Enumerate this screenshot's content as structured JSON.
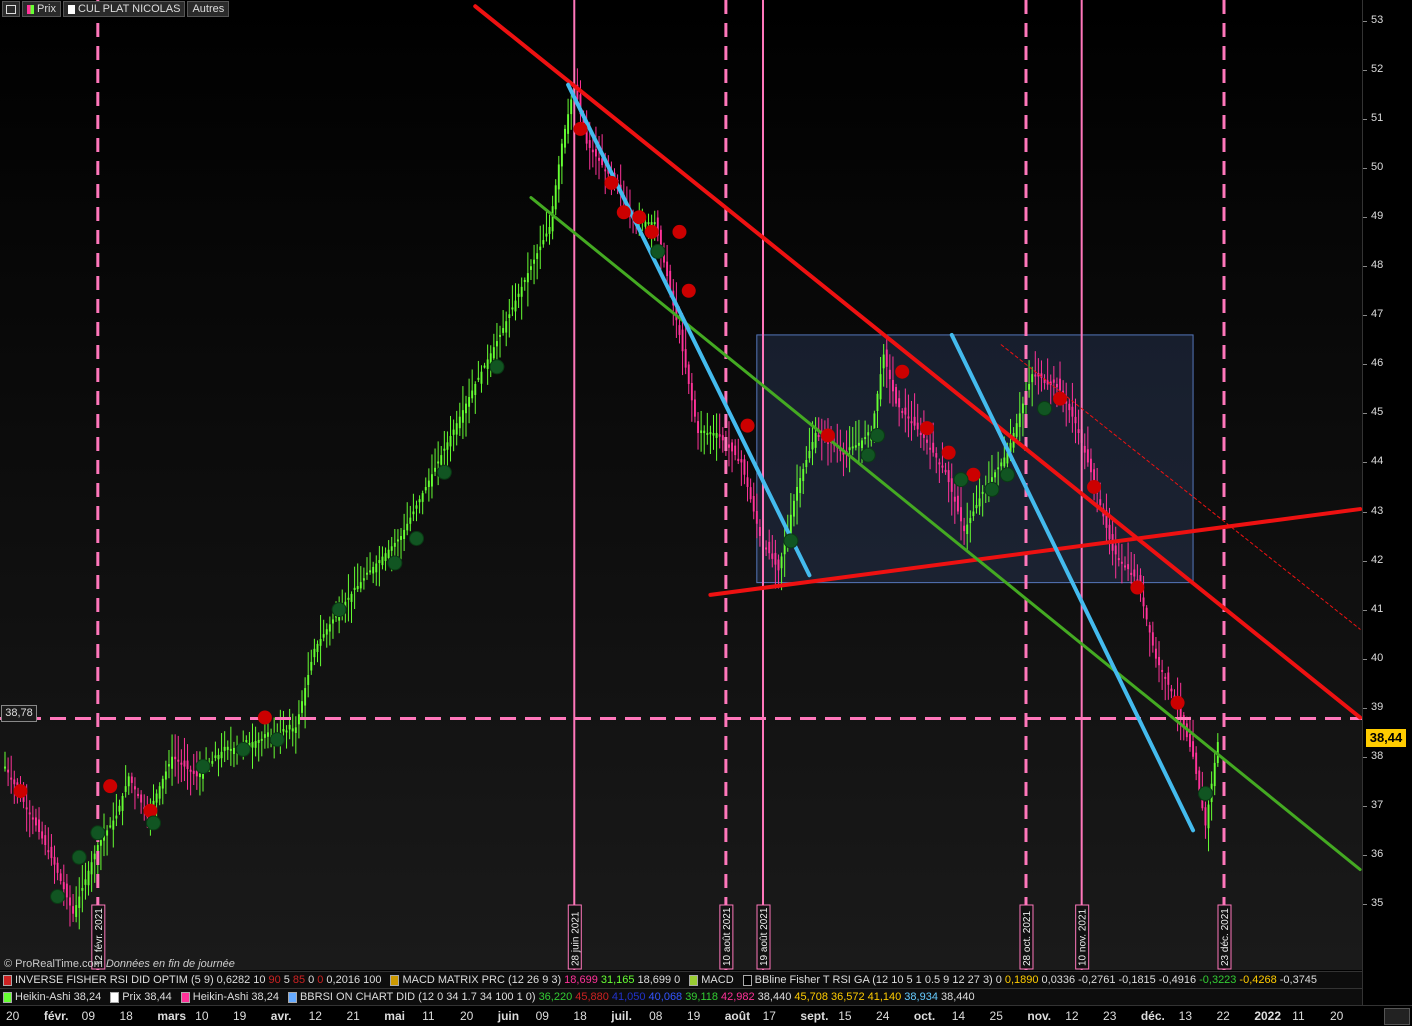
{
  "toolbar": {
    "prix_label": "Prix",
    "model_label": "CUL PLAT NICOLAS",
    "autres_label": "Autres"
  },
  "left_price_tag": "38,78",
  "current_price_tag": "38,44",
  "watermark": {
    "brand": "© ProRealTime.com",
    "note": "Données en fin de journée"
  },
  "legend_row1": [
    {
      "label": "INVERSE FISHER RSI DID OPTIM (5 9)",
      "color": "#cc2222",
      "values": [
        {
          "v": "0,6282",
          "c": "#ddd"
        },
        {
          "v": "10",
          "c": "#ddd"
        },
        {
          "v": "90",
          "c": "#cc2222"
        },
        {
          "v": "5",
          "c": "#ddd"
        },
        {
          "v": "85",
          "c": "#cc2222"
        },
        {
          "v": "0",
          "c": "#ddd"
        },
        {
          "v": "0",
          "c": "#cc2222"
        },
        {
          "v": "0,2016",
          "c": "#ddd"
        },
        {
          "v": "100",
          "c": "#ddd"
        }
      ]
    },
    {
      "label": "MACD MATRIX PRC (12 26 9 3)",
      "color": "#cc9900",
      "values": [
        {
          "v": "18,699",
          "c": "#ff3399"
        },
        {
          "v": "31,165",
          "c": "#66ff33"
        },
        {
          "v": "18,699",
          "c": "#ddd"
        },
        {
          "v": "0",
          "c": "#ddd"
        }
      ]
    },
    {
      "label": "MACD",
      "color": "#99cc33",
      "values": []
    },
    {
      "label": "BBline  Fisher T RSI  GA (12 10 5 1 0.5 9 12 27 3)",
      "color": "#000",
      "values": [
        {
          "v": "0",
          "c": "#ddd"
        },
        {
          "v": "0,1890",
          "c": "#ffcc00"
        },
        {
          "v": "0,0336",
          "c": "#ddd"
        },
        {
          "v": "-0,2761",
          "c": "#ddd"
        },
        {
          "v": "-0,1815",
          "c": "#ddd"
        },
        {
          "v": "-0,4916",
          "c": "#ddd"
        },
        {
          "v": "-0,3223",
          "c": "#33cc33"
        },
        {
          "v": "-0,4268",
          "c": "#ffcc00"
        },
        {
          "v": "-0,3745",
          "c": "#ddd"
        }
      ]
    }
  ],
  "legend_row2": [
    {
      "label": "Heikin-Ashi 38,24",
      "color": "#66ff33",
      "values": []
    },
    {
      "label": "Prix 38,44",
      "color": "#ffffff",
      "values": []
    },
    {
      "label": "Heikin-Ashi 38,24",
      "color": "#ff3399",
      "values": []
    },
    {
      "label": "BBRSI ON CHART DID (12 0 34 1.7 34 100 1 0)",
      "color": "#66aaff",
      "values": [
        {
          "v": "36,220",
          "c": "#33cc33"
        },
        {
          "v": "45,880",
          "c": "#cc2222"
        },
        {
          "v": "41,050",
          "c": "#2233cc"
        },
        {
          "v": "40,068",
          "c": "#3355ff"
        },
        {
          "v": "39,118",
          "c": "#33cc33"
        },
        {
          "v": "42,982",
          "c": "#ff3399"
        },
        {
          "v": "38,440",
          "c": "#ddd"
        },
        {
          "v": "45,708",
          "c": "#ffcc00"
        },
        {
          "v": "36,572",
          "c": "#ffcc00"
        },
        {
          "v": "41,140",
          "c": "#ffcc00"
        },
        {
          "v": "38,934",
          "c": "#66ccff"
        },
        {
          "v": "38,440",
          "c": "#ddd"
        }
      ]
    }
  ],
  "colors": {
    "bull": "#66ff33",
    "bear": "#ff3399",
    "trend_red": "#ee1111",
    "trend_blue": "#44bbee",
    "trend_green": "#44aa22",
    "dash_pink": "#ff77bb",
    "box_fill": "#2a3a5a",
    "box_stroke": "#5577bb",
    "dot_red": "#cc0000",
    "dot_green": "#115522"
  },
  "chart_data": {
    "type": "candlestick",
    "title": "",
    "y_ticks": [
      35,
      36,
      37,
      38,
      39,
      40,
      41,
      42,
      43,
      44,
      45,
      46,
      47,
      48,
      49,
      50,
      51,
      52,
      53
    ],
    "ylim": [
      34,
      53.3
    ],
    "x_ticks": [
      "20",
      "févr.",
      "09",
      "18",
      "mars",
      "10",
      "19",
      "avr.",
      "12",
      "21",
      "mai",
      "11",
      "20",
      "juin",
      "09",
      "18",
      "juil.",
      "08",
      "19",
      "août",
      "17",
      "sept.",
      "15",
      "24",
      "oct.",
      "14",
      "25",
      "nov.",
      "12",
      "23",
      "déc.",
      "13",
      "22",
      "2022",
      "11",
      "20"
    ],
    "x_tick_bold": [
      "févr.",
      "mars",
      "avr.",
      "mai",
      "juin",
      "juil.",
      "août",
      "sept.",
      "oct.",
      "nov.",
      "déc.",
      "2022"
    ],
    "n_bars": 260,
    "price_path": [
      [
        0,
        37.8
      ],
      [
        10,
        36.6
      ],
      [
        16,
        35.8
      ],
      [
        22,
        34.8
      ],
      [
        30,
        36.2
      ],
      [
        36,
        36.8
      ],
      [
        40,
        37.6
      ],
      [
        46,
        36.8
      ],
      [
        54,
        38.0
      ],
      [
        62,
        37.6
      ],
      [
        70,
        38.1
      ],
      [
        80,
        38.3
      ],
      [
        94,
        38.6
      ],
      [
        100,
        40.2
      ],
      [
        108,
        41.0
      ],
      [
        118,
        41.8
      ],
      [
        128,
        42.5
      ],
      [
        136,
        43.5
      ],
      [
        146,
        44.8
      ],
      [
        152,
        45.6
      ],
      [
        160,
        46.6
      ],
      [
        170,
        48.0
      ],
      [
        176,
        48.8
      ],
      [
        180,
        50.5
      ],
      [
        184,
        51.7
      ],
      [
        188,
        50.5
      ],
      [
        196,
        49.8
      ],
      [
        204,
        48.9
      ],
      [
        210,
        48.9
      ],
      [
        214,
        47.8
      ],
      [
        218,
        46.6
      ],
      [
        224,
        44.6
      ],
      [
        230,
        44.6
      ],
      [
        238,
        44.0
      ],
      [
        244,
        42.5
      ],
      [
        250,
        41.8
      ],
      [
        256,
        43.5
      ],
      [
        262,
        44.6
      ],
      [
        272,
        44.2
      ],
      [
        280,
        44.6
      ],
      [
        284,
        46.2
      ],
      [
        288,
        45.2
      ],
      [
        296,
        44.6
      ],
      [
        304,
        43.8
      ],
      [
        310,
        42.6
      ],
      [
        316,
        43.4
      ],
      [
        324,
        44.2
      ],
      [
        332,
        45.8
      ],
      [
        340,
        45.6
      ],
      [
        346,
        44.8
      ],
      [
        352,
        43.6
      ],
      [
        358,
        42.2
      ],
      [
        366,
        41.6
      ],
      [
        372,
        40.0
      ],
      [
        378,
        39.2
      ],
      [
        384,
        38.0
      ],
      [
        388,
        36.6
      ],
      [
        392,
        38.3
      ]
    ],
    "x_span": 392,
    "vertical_solid": [
      {
        "date_label": "28 juin 2021",
        "t": 184
      },
      {
        "date_label": "19 août 2021",
        "t": 245
      },
      {
        "date_label": "10 nov. 2021",
        "t": 348
      }
    ],
    "vertical_dashed": [
      {
        "date_label": "12 févr. 2021",
        "t": 30
      },
      {
        "date_label": "10 août 2021",
        "t": 233
      },
      {
        "date_label": "28 oct. 2021",
        "t": 330
      },
      {
        "date_label": "23 déc. 2021",
        "t": 394
      }
    ],
    "horizontal_dashed_price": 38.78,
    "trendlines": [
      {
        "name": "resistance",
        "color": "trend_red",
        "p1": [
          152,
          53.3
        ],
        "p2": [
          438,
          38.8
        ],
        "width": 4
      },
      {
        "name": "support",
        "color": "trend_red",
        "p1": [
          228,
          41.3
        ],
        "p2": [
          438,
          43.05
        ],
        "width": 4
      },
      {
        "name": "channel-green",
        "color": "trend_green",
        "p1": [
          170,
          49.4
        ],
        "p2": [
          438,
          35.7
        ],
        "width": 3
      },
      {
        "name": "blue-1",
        "color": "trend_blue",
        "p1": [
          182,
          51.7
        ],
        "p2": [
          260,
          41.7
        ],
        "width": 4
      },
      {
        "name": "blue-2",
        "color": "trend_blue",
        "p1": [
          306,
          46.6
        ],
        "p2": [
          384,
          36.5
        ],
        "width": 4
      },
      {
        "name": "dotted-red",
        "color": "trend_red",
        "p1": [
          322,
          46.4
        ],
        "p2": [
          438,
          40.6
        ],
        "width": 1,
        "dash": true
      }
    ],
    "box": {
      "t1": 243,
      "t2": 384,
      "p1": 46.6,
      "p2": 41.55
    },
    "sell_signals": [
      [
        5,
        37.3
      ],
      [
        34,
        37.4
      ],
      [
        47,
        36.9
      ],
      [
        84,
        38.8
      ],
      [
        186,
        50.8
      ],
      [
        196,
        49.7
      ],
      [
        200,
        49.1
      ],
      [
        205,
        49.0
      ],
      [
        209,
        48.7
      ],
      [
        218,
        48.7
      ],
      [
        221,
        47.5
      ],
      [
        240,
        44.75
      ],
      [
        266,
        44.55
      ],
      [
        290,
        45.85
      ],
      [
        298,
        44.7
      ],
      [
        305,
        44.2
      ],
      [
        313,
        43.75
      ],
      [
        341,
        45.3
      ],
      [
        352,
        43.5
      ],
      [
        366,
        41.45
      ],
      [
        379,
        39.1
      ]
    ],
    "buy_signals": [
      [
        17,
        35.15
      ],
      [
        24,
        35.95
      ],
      [
        30,
        36.45
      ],
      [
        48,
        36.65
      ],
      [
        64,
        37.8
      ],
      [
        77,
        38.15
      ],
      [
        88,
        38.35
      ],
      [
        108,
        41.0
      ],
      [
        126,
        41.95
      ],
      [
        133,
        42.45
      ],
      [
        142,
        43.8
      ],
      [
        159,
        45.95
      ],
      [
        211,
        48.3
      ],
      [
        254,
        42.4
      ],
      [
        279,
        44.15
      ],
      [
        282,
        44.55
      ],
      [
        309,
        43.65
      ],
      [
        319,
        43.45
      ],
      [
        324,
        43.75
      ],
      [
        336,
        45.1
      ],
      [
        388,
        37.25
      ]
    ]
  }
}
